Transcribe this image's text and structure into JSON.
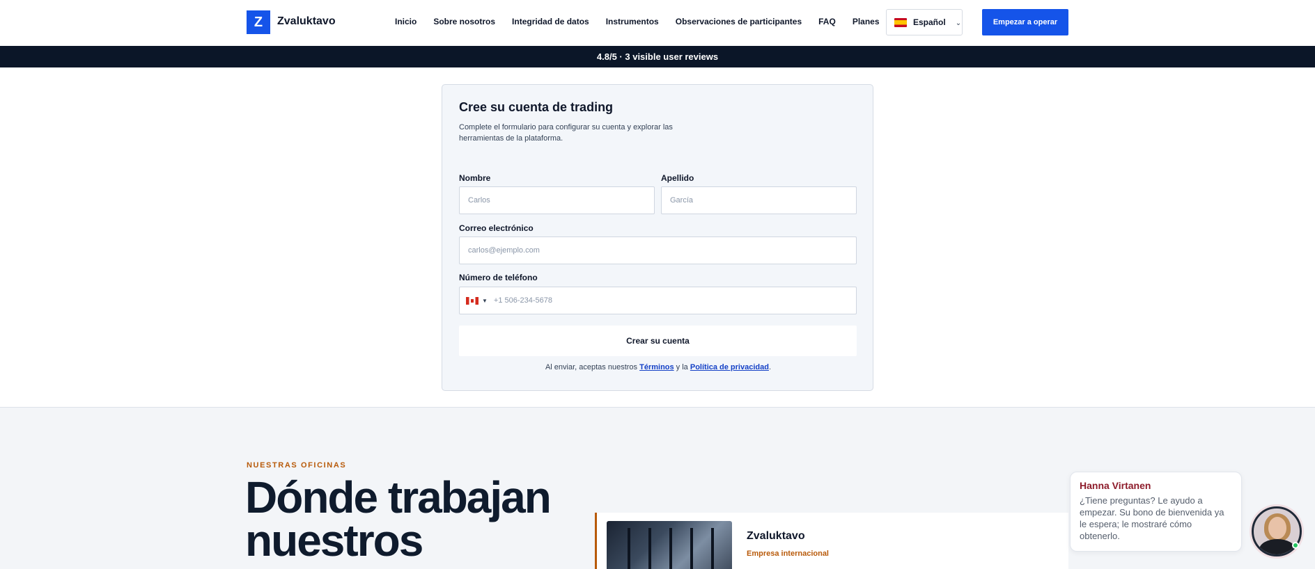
{
  "header": {
    "logo_letter": "Z",
    "brand": "Zvaluktavo",
    "nav": [
      "Inicio",
      "Sobre nosotros",
      "Integridad de datos",
      "Instrumentos",
      "Observaciones de participantes",
      "FAQ",
      "Planes"
    ],
    "language": "Español",
    "cta": "Empezar a operar"
  },
  "ribbon": {
    "text": "4.8/5 · 3 visible user reviews"
  },
  "form": {
    "title": "Cree su cuenta de trading",
    "subtitle": "Complete el formulario para configurar su cuenta y explorar las herramientas de la plataforma.",
    "first_name": {
      "label": "Nombre",
      "placeholder": "Carlos"
    },
    "last_name": {
      "label": "Apellido",
      "placeholder": "García"
    },
    "email": {
      "label": "Correo electrónico",
      "placeholder": "carlos@ejemplo.com"
    },
    "phone": {
      "label": "Número de teléfono",
      "placeholder": "+1 506-234-5678"
    },
    "submit": "Crear su cuenta",
    "terms": {
      "prefix": "Al enviar, aceptas nuestros ",
      "terms_link": "Términos",
      "middle": " y la ",
      "privacy_link": "Política de privacidad",
      "suffix": "."
    }
  },
  "offices": {
    "eyebrow": "NUESTRAS OFICINAS",
    "title": "Dónde trabajan nuestros",
    "card": {
      "name": "Zvaluktavo",
      "tag": "Empresa internacional"
    }
  },
  "chat": {
    "agent": "Hanna Virtanen",
    "message": "¿Tiene preguntas? Le ayudo a empezar. Su bono de bienvenida ya le espera; le mostraré cómo obtenerlo."
  },
  "colors": {
    "primary": "#1554e9",
    "ribbon": "#0b1628",
    "accent": "#b85a0a",
    "chat_name": "#8d1b2a"
  }
}
